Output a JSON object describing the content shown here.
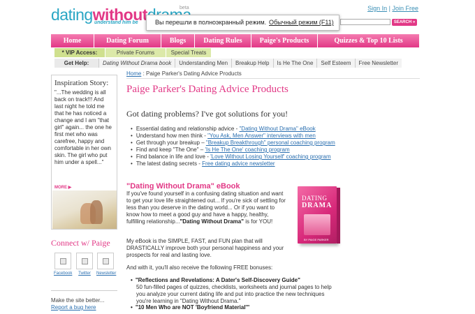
{
  "header": {
    "logo_part1": "dating",
    "logo_part2": "without",
    "logo_part3": "drama",
    "beta": "beta",
    "tagline": "understand him be",
    "signin": "Sign In",
    "separator": " | ",
    "join": "Join Free",
    "search_button": "SEARCH »"
  },
  "fullscreen_notice": {
    "message": "Вы перешли в полноэкранный режим.",
    "link": "Обычный режим (F11)"
  },
  "main_nav": [
    {
      "label": "Home"
    },
    {
      "label": "Dating Forum"
    },
    {
      "label": "Blogs"
    },
    {
      "label": "Dating Rules"
    },
    {
      "label": "Paige's Products"
    },
    {
      "label": "Quizzes & Top 10 Lists"
    }
  ],
  "vip_bar": {
    "label": "* VIP Access:",
    "items": [
      "Private Forums",
      "Special Treats"
    ]
  },
  "help_bar": {
    "label": "Get Help:",
    "items": [
      "Dating Without Drama book",
      "Understanding Men",
      "Breakup Help",
      "Is He The One",
      "Self Esteem",
      "Free Newsletter"
    ]
  },
  "sidebar": {
    "story_title": "Inspiration Story:",
    "story_text": "\"...The wedding is all back on track!!! And last night he told me that he has noticed a change and I am \"that girl\" again... the one he first met who was carefree, happy and comfortable in her own skin. The girl who put him under a spell...\"",
    "more": "MORE ▶",
    "connect_title": "Connect w/ Paige",
    "social": [
      "Facebook",
      "Twitter",
      "Newsletter"
    ],
    "feedback_text": "Make the site better...",
    "feedback_link": "Report a bug here"
  },
  "content": {
    "breadcrumb_home": "Home",
    "breadcrumb_rest": " : Paige Parker's Dating Advice Products",
    "title": "Paige Parker's Dating Advice Products",
    "subtitle": "Got dating problems? I've got solutions for you!",
    "bullets": [
      {
        "text": "Essential dating and relationship advice - ",
        "link": "\"Dating Without Drama\" eBook"
      },
      {
        "text": "Understand how men think - ",
        "link": "\"You Ask, Men Answer\" interviews with men"
      },
      {
        "text": "Get through your breakup – ",
        "link": "\"Breakup Breakthrough\" personal coaching program"
      },
      {
        "text": "Find and keep \"The One\" – ",
        "link": "'Is He The One' coaching program"
      },
      {
        "text": "Find balance in life and love - ",
        "link": "'Love Without Losing Yourself' coaching program"
      },
      {
        "text": "The latest dating secrets - ",
        "link": "Free dating advice newsletter"
      }
    ],
    "ebook_title": "\"Dating Without Drama\" eBook",
    "ebook_p1": "If you've found yourself in a confusing dating situation and want to get your love life straightened out... If you're sick of settling for less than you deserve in the dating world... Or if you want to know how to meet a good guy and have a happy, healthy, fulfilling relationship...",
    "ebook_p1_bold": "\"Dating Without Drama\"",
    "ebook_p1_end": " is for YOU!",
    "ebook_p2": "My eBook is the SIMPLE, FAST, and FUN plan that will DRASTICALLY improve both your personal happiness and your prospects for real and lasting love.",
    "ebook_p3": "And with it, you'll also receive the following FREE bonuses:",
    "book_cover_t1": "DATING",
    "book_cover_t2": "DRAMA",
    "book_cover_author": "BY PAIGE PARKER",
    "bonus1_title": "\"Reflections and Revelations: A Dater's Self-Discovery Guide\"",
    "bonus1_text": "50 fun-filled pages of quizzes, checklists, worksheets and journal pages to help you analyze your current dating life and put into practice the new techniques you're learning in \"Dating Without Drama.\"",
    "bonus2_title": "\"10 Men Who are NOT 'Boyfriend Material'\""
  }
}
